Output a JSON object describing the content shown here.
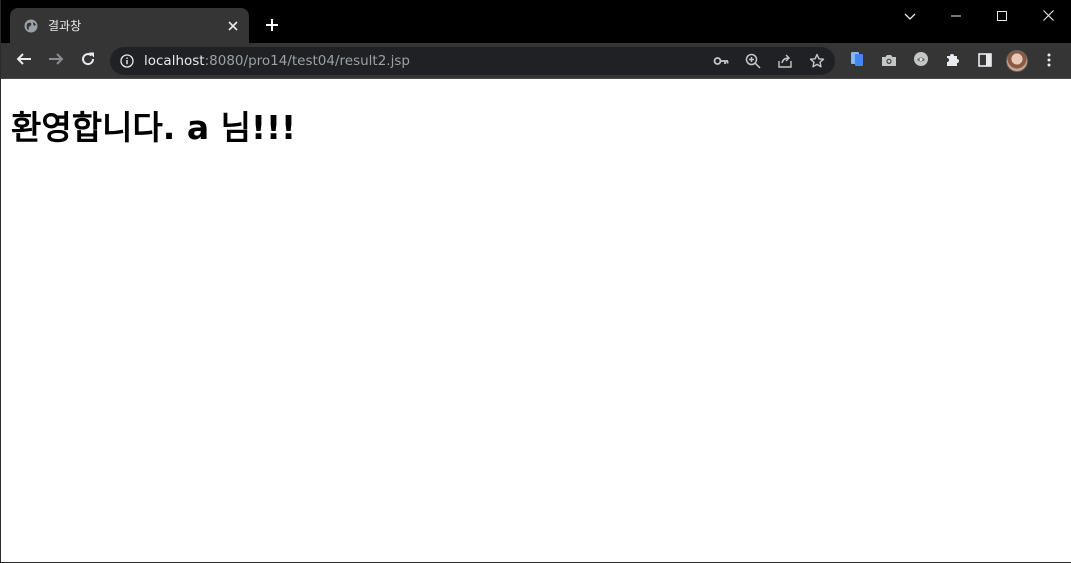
{
  "tab": {
    "title": "결과창"
  },
  "address_bar": {
    "host": "localhost",
    "path": ":8080/pro14/test04/result2.jsp"
  },
  "page": {
    "heading": "환영합니다. a 님!!!"
  },
  "colors": {
    "tabstrip_bg": "#000000",
    "toolbar_bg": "#353535",
    "omnibox_bg": "#202124",
    "text_light": "#e8eaed",
    "text_muted": "#9aa0a6"
  },
  "icons": {
    "favicon": "globe-icon",
    "tab_close": "close-icon",
    "new_tab": "plus-icon",
    "tab_search": "chevron-down-icon",
    "minimize": "minimize-icon",
    "maximize": "maximize-icon",
    "close_window": "close-icon",
    "back": "arrow-left-icon",
    "forward": "arrow-right-icon",
    "reload": "reload-icon",
    "site_info": "info-icon",
    "passwords": "key-icon",
    "zoom": "zoom-in-icon",
    "share": "share-icon",
    "bookmark": "star-icon",
    "extensions": [
      "clipboard-icon",
      "camera-icon",
      "extension-circle-icon",
      "puzzle-icon"
    ],
    "side_panel": "side-panel-icon",
    "profile": "avatar",
    "menu": "kebab-menu-icon"
  }
}
